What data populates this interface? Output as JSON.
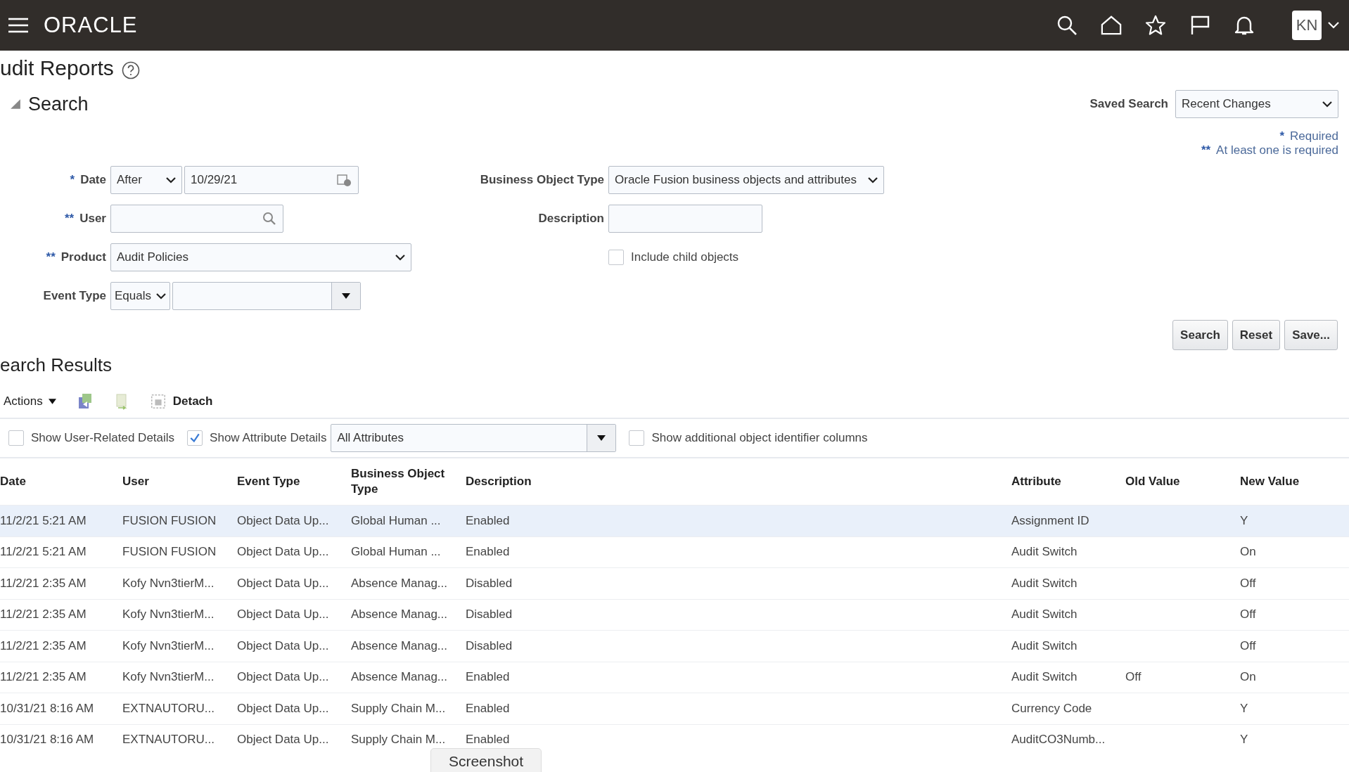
{
  "header": {
    "logo": "ORACLE",
    "avatar": "KN"
  },
  "page_title": "udit Reports",
  "search_section": {
    "title": "Search",
    "expanded": true,
    "saved_search": {
      "label": "Saved Search",
      "value": "Recent Changes"
    },
    "notes": [
      {
        "mark": "*",
        "text": "Required"
      },
      {
        "mark": "**",
        "text": "At least one is required"
      }
    ],
    "fields_left": [
      {
        "kind": "date",
        "mark": "*",
        "label": "Date",
        "operator": "After",
        "value": "10/29/21"
      },
      {
        "kind": "search",
        "mark": "**",
        "label": "User"
      },
      {
        "kind": "select",
        "mark": "**",
        "label": "Product",
        "value": "Audit Policies"
      },
      {
        "kind": "combo",
        "label": "Event Type",
        "operator": "Equals"
      }
    ],
    "fields_right": [
      {
        "kind": "select",
        "label": "Business Object Type",
        "value": "Oracle Fusion business objects and attributes"
      },
      {
        "kind": "text",
        "label": "Description"
      },
      {
        "kind": "checkbox",
        "label": "Include child objects",
        "checked": false
      }
    ],
    "buttons": [
      "Search",
      "Reset",
      "Save..."
    ]
  },
  "results": {
    "title": "earch Results",
    "toolbar": {
      "actions": "Actions",
      "detach": "Detach"
    },
    "options": [
      {
        "label": "Show User-Related Details",
        "checked": false
      },
      {
        "label": "Show Attribute Details",
        "checked": true
      }
    ],
    "attribute_filter": "All Attributes",
    "extra_option": {
      "label": "Show additional object identifier columns",
      "checked": false
    },
    "columns": [
      "Date",
      "User",
      "Event Type",
      "Business Object Type",
      "Description",
      "Attribute",
      "Old Value",
      "New Value"
    ],
    "rows": [
      {
        "selected": true,
        "cells": [
          "11/2/21 5:21 AM",
          "FUSION FUSION",
          "Object Data Up...",
          "Global Human ...",
          "Enabled",
          "Assignment ID",
          "",
          "Y"
        ]
      },
      {
        "selected": false,
        "cells": [
          "11/2/21 5:21 AM",
          "FUSION FUSION",
          "Object Data Up...",
          "Global Human ...",
          "Enabled",
          "Audit Switch",
          "",
          "On"
        ]
      },
      {
        "selected": false,
        "cells": [
          "11/2/21 2:35 AM",
          "Kofy Nvn3tierM...",
          "Object Data Up...",
          "Absence Manag...",
          "Disabled",
          "Audit Switch",
          "",
          "Off"
        ]
      },
      {
        "selected": false,
        "cells": [
          "11/2/21 2:35 AM",
          "Kofy Nvn3tierM...",
          "Object Data Up...",
          "Absence Manag...",
          "Disabled",
          "Audit Switch",
          "",
          "Off"
        ]
      },
      {
        "selected": false,
        "cells": [
          "11/2/21 2:35 AM",
          "Kofy Nvn3tierM...",
          "Object Data Up...",
          "Absence Manag...",
          "Disabled",
          "Audit Switch",
          "",
          "Off"
        ]
      },
      {
        "selected": false,
        "cells": [
          "11/2/21 2:35 AM",
          "Kofy Nvn3tierM...",
          "Object Data Up...",
          "Absence Manag...",
          "Enabled",
          "Audit Switch",
          "Off",
          "On"
        ]
      },
      {
        "selected": false,
        "cells": [
          "10/31/21 8:16 AM",
          "EXTNAUTORU...",
          "Object Data Up...",
          "Supply Chain M...",
          "Enabled",
          "Currency Code",
          "",
          "Y"
        ]
      },
      {
        "selected": false,
        "cells": [
          "10/31/21 8:16 AM",
          "EXTNAUTORU...",
          "Object Data Up...",
          "Supply Chain M...",
          "Enabled",
          "AuditCO3Numb...",
          "",
          "Y"
        ]
      }
    ]
  },
  "tooltip": "Screenshot"
}
